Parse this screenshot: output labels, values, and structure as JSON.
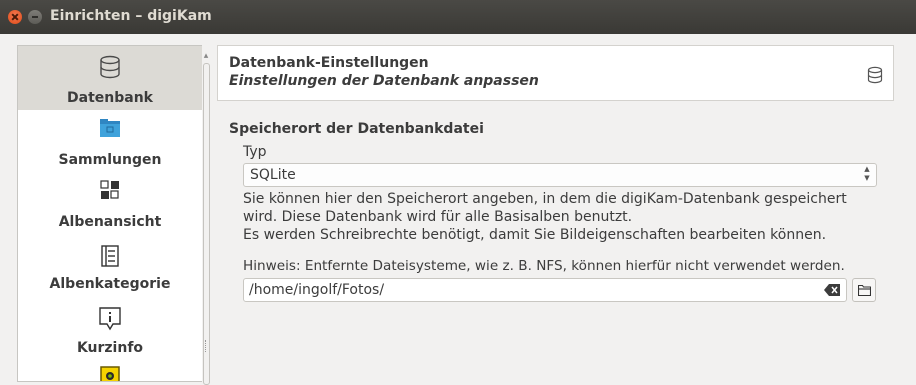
{
  "window": {
    "title": "Einrichten – digiKam"
  },
  "sidebar": {
    "items": [
      {
        "label": "Datenbank",
        "icon": "database-icon",
        "selected": true
      },
      {
        "label": "Sammlungen",
        "icon": "folder-pictures-icon"
      },
      {
        "label": "Albenansicht",
        "icon": "view-grid-icon"
      },
      {
        "label": "Albenkategorie",
        "icon": "list-icon"
      },
      {
        "label": "Kurzinfo",
        "icon": "info-icon"
      },
      {
        "label": "",
        "icon": "image-icon"
      }
    ]
  },
  "header": {
    "title": "Datenbank-Einstellungen",
    "subtitle": "Einstellungen der Datenbank anpassen",
    "icon": "database-icon"
  },
  "main": {
    "section_title": "Speicherort der Datenbankdatei",
    "type_label": "Typ",
    "type_value": "SQLite",
    "info_line1": "Sie können hier den Speicherort angeben, in dem die digiKam-Datenbank gespeichert",
    "info_line2": "wird. Diese Datenbank wird für alle Basisalben benutzt.",
    "info_line3": "Es werden Schreibrechte benötigt, damit Sie Bildeigenschaften bearbeiten können.",
    "hint": "Hinweis: Entfernte Dateisysteme, wie z. B. NFS, können hierfür nicht verwendet werden.",
    "path_value": "/home/ingolf/Fotos/"
  },
  "colors": {
    "titlebar": "#3c3b37",
    "close": "#df4a16",
    "folder_blue": "#3fa2db",
    "selection": "#dcdad5"
  }
}
